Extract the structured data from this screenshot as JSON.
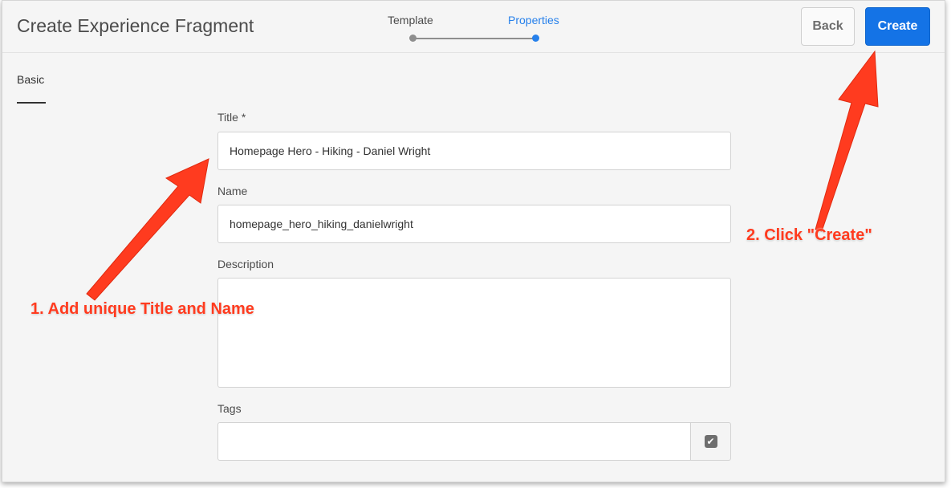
{
  "header": {
    "title": "Create Experience Fragment",
    "wizard": {
      "step1": "Template",
      "step2": "Properties",
      "active_step": 2
    },
    "back_label": "Back",
    "create_label": "Create"
  },
  "tabs": {
    "basic": "Basic"
  },
  "form": {
    "title_label": "Title *",
    "title_value": "Homepage Hero - Hiking - Daniel Wright",
    "name_label": "Name",
    "name_value": "homepage_hero_hiking_danielwright",
    "description_label": "Description",
    "description_value": "",
    "tags_label": "Tags",
    "tags_value": ""
  },
  "annotations": {
    "step1": "1. Add unique Title and Name",
    "step2": "2. Click \"Create\""
  },
  "colors": {
    "accent": "#1473e6",
    "annotation": "#ff3b1f"
  },
  "icons": {
    "tags_picker": "checkbox-check-icon"
  }
}
